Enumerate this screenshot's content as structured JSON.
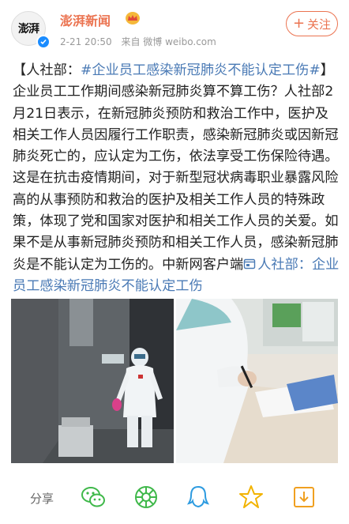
{
  "account": {
    "avatar_text": "澎湃",
    "name": "澎湃新闻",
    "time": "2-21 20:50",
    "source": "来自 微博 weibo.com",
    "follow_label": "关注"
  },
  "post": {
    "topic_prefix": "【人社部：",
    "topic": "#企业员工感染新冠肺炎不能认定工伤#",
    "text": "】企业员工工作期间感染新冠肺炎算不算工伤？人社部2月21日表示，在新冠肺炎预防和救治工作中，医护及相关工作人员因履行工作职责，感染新冠肺炎或因新冠肺炎死亡的，应认定为工伤，依法享受工伤保险待遇。这是在抗击疫情期间，对于新型冠状病毒职业暴露风险高的从事预防和救治的医护及相关工作人员的特殊政策，体现了党和国家对医护和相关工作人员的关爱。如果不是从事新冠肺炎预防和相关工作人员，感染新冠肺炎是不能认定为工伤的。中新网客户端",
    "link_icon": "link-icon",
    "link_text": "人社部：企业员工感染新冠肺炎不能认定工伤"
  },
  "media": {
    "image_left": "hospital-corridor-photo",
    "image_right": "doctor-writing-photo"
  },
  "actions": {
    "share_label": "分享",
    "icons": [
      "wechat-icon",
      "moments-icon",
      "qq-icon",
      "qzone-icon",
      "save-image-icon"
    ]
  },
  "colors": {
    "brand": "#eb7350",
    "link": "#4a7ab5",
    "meta": "#999999"
  }
}
